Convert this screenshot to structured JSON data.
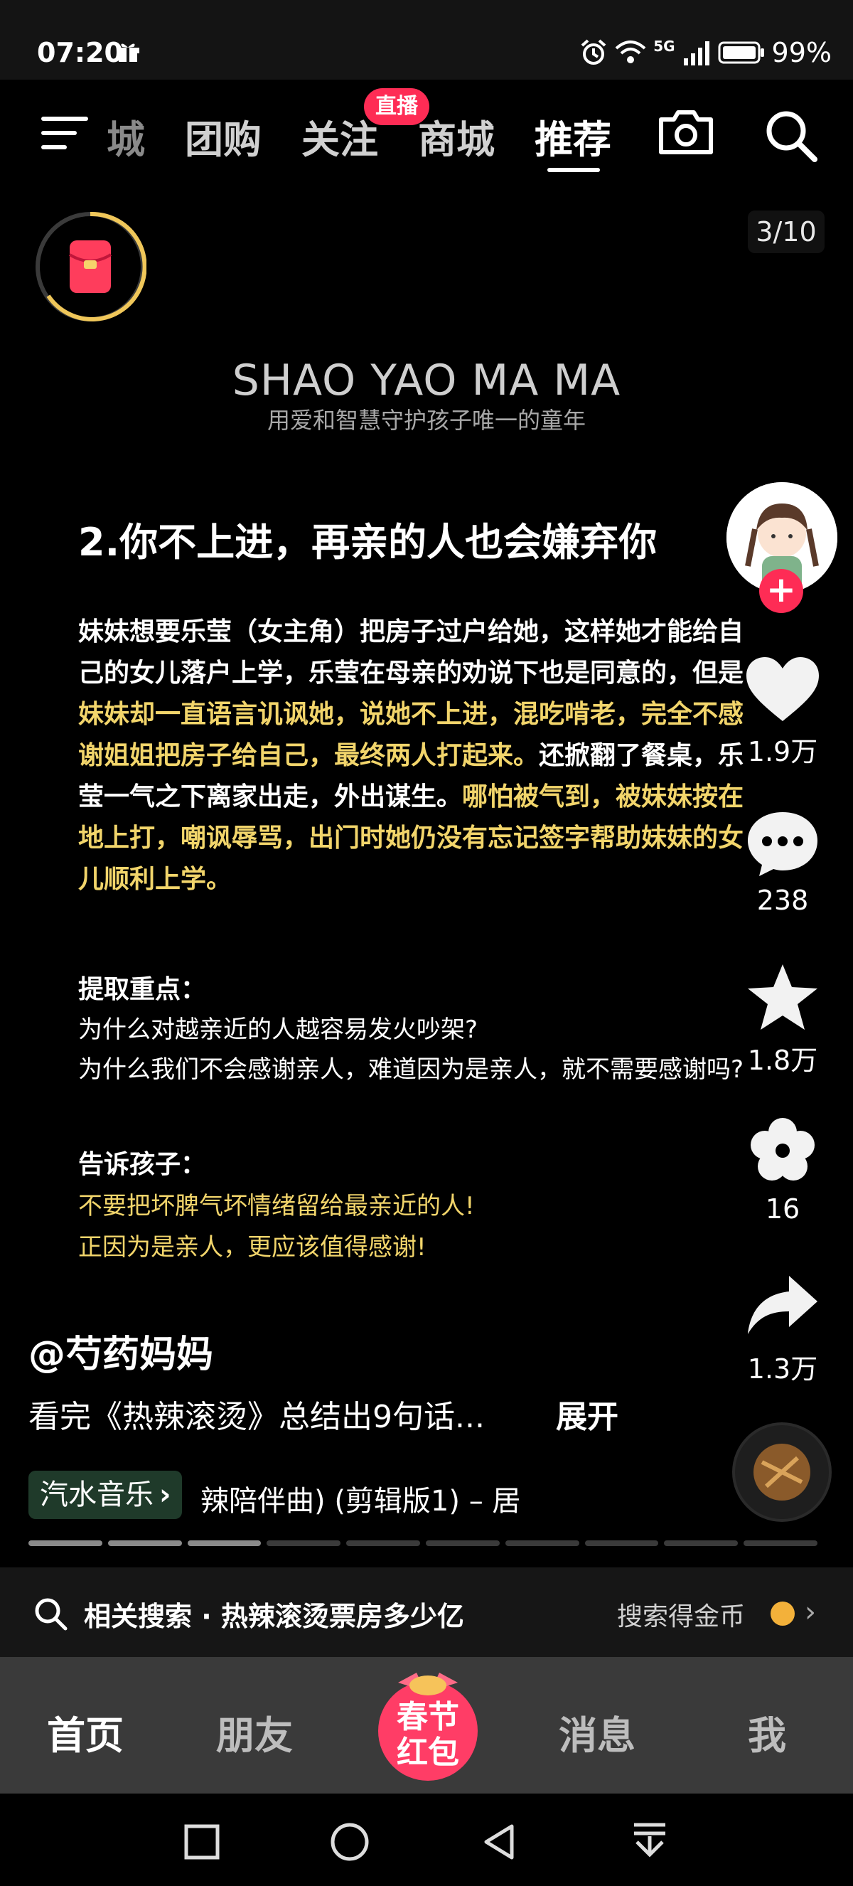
{
  "status_bar": {
    "time": "07:20",
    "battery": "99%",
    "network": "5G"
  },
  "top_nav": {
    "tabs": [
      "城",
      "团购",
      "关注",
      "商城",
      "推荐"
    ],
    "live_badge": "直播",
    "active_tab": "推荐"
  },
  "content": {
    "page_counter": "3/10",
    "brand_title": "SHAO YAO MA MA",
    "brand_subtitle": "用爱和智慧守护孩子唯一的童年",
    "heading": "2.你不上进，再亲的人也会嫌弃你",
    "paragraph": {
      "p1": "妹妹想要乐莹（女主角）把房子过户给她，这样她才能给自己的女儿落户上学，乐莹在母亲的劝说下也是同意的，但是",
      "p2": "妹妹却一直语言讥讽她，说她不上进，混吃啃老，完全不感谢姐姐把房子给自己，最终两人打起来。",
      "p3": "还掀翻了餐桌，乐莹一气之下离家出走，外出谋生。",
      "p4": "哪怕被气到，被妹妹按在地上打，嘲讽辱骂，出门时她仍没有忘记签字帮助妹妹的女儿顺利上学。"
    },
    "key_points": {
      "title": "提取重点：",
      "lines": [
        "为什么对越亲近的人越容易发火吵架?",
        "为什么我们不会感谢亲人，难道因为是亲人，就不需要感谢吗?"
      ]
    },
    "tell_kids": {
      "title": "告诉孩子：",
      "lines": [
        "不要把坏脾气坏情绪留给最亲近的人!",
        "正因为是亲人，更应该值得感谢!"
      ]
    }
  },
  "right_rail": {
    "likes": "1.9万",
    "comments": "238",
    "favorites": "1.8万",
    "flowers": "16",
    "shares": "1.3万"
  },
  "post": {
    "author": "@芍药妈妈",
    "description": "看完《热辣滚烫》总结出9句话...",
    "expand": "展开",
    "music_tag": "汽水音乐",
    "music_name": "辣陪伴曲) (剪辑版1) – 居",
    "progress": {
      "current": 3,
      "total": 10
    }
  },
  "related_search": {
    "label": "相关搜索 · 热辣滚烫票房多少亿",
    "right_text": "搜索得金币"
  },
  "bottom_nav": {
    "home": "首页",
    "friends": "朋友",
    "spring_line1": "春节",
    "spring_line2": "红包",
    "messages": "消息",
    "me": "我"
  }
}
